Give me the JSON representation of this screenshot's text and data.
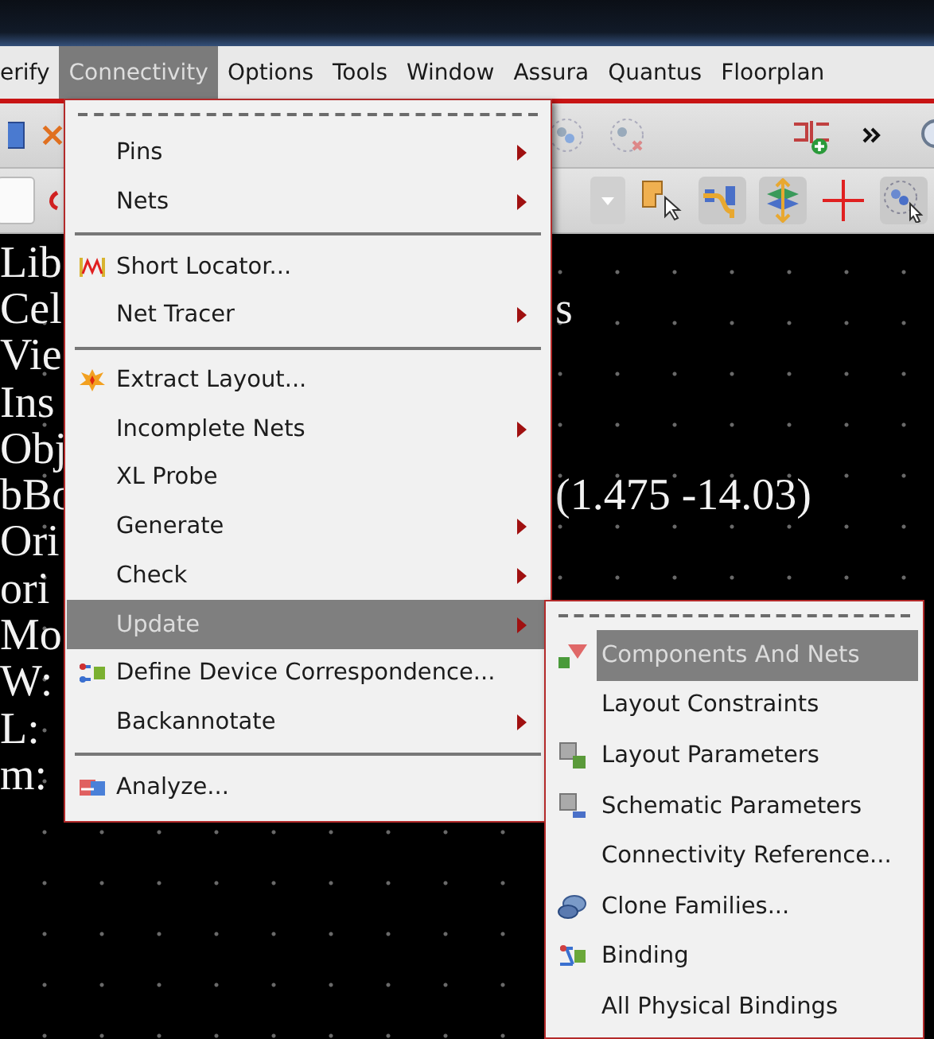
{
  "menubar": [
    {
      "label": "erify",
      "selected": false
    },
    {
      "label": "Connectivity",
      "selected": true
    },
    {
      "label": "Options",
      "selected": false
    },
    {
      "label": "Tools",
      "selected": false
    },
    {
      "label": "Window",
      "selected": false
    },
    {
      "label": "Assura",
      "selected": false
    },
    {
      "label": "Quantus",
      "selected": false
    },
    {
      "label": "Floorplan",
      "selected": false
    }
  ],
  "canvas_text": [
    {
      "left": "Lib"
    },
    {
      "left": "Cel",
      "right": "s"
    },
    {
      "left": "Vie"
    },
    {
      "left": "Ins"
    },
    {
      "left": "Obj"
    },
    {
      "left": "bBo",
      "right": "(1.475 -14.03)"
    },
    {
      "left": "Ori"
    },
    {
      "left": "ori"
    },
    {
      "left": "Mo"
    },
    {
      "left": "W:"
    },
    {
      "left": "L:"
    },
    {
      "left": "m:"
    }
  ],
  "menu": {
    "items": [
      {
        "kind": "dashed_separator"
      },
      {
        "kind": "item",
        "label": "Pins",
        "submenu": true,
        "selected": false,
        "icon": false
      },
      {
        "kind": "item",
        "label": "Nets",
        "submenu": true,
        "selected": false,
        "icon": false
      },
      {
        "kind": "separator"
      },
      {
        "kind": "item",
        "label": "Short Locator...",
        "submenu": false,
        "selected": false,
        "icon": true
      },
      {
        "kind": "item",
        "label": "Net Tracer",
        "submenu": true,
        "selected": false,
        "icon": false
      },
      {
        "kind": "separator"
      },
      {
        "kind": "item",
        "label": "Extract Layout...",
        "submenu": false,
        "selected": false,
        "icon": true
      },
      {
        "kind": "item",
        "label": "Incomplete Nets",
        "submenu": true,
        "selected": false,
        "icon": false
      },
      {
        "kind": "item",
        "label": "XL Probe",
        "submenu": false,
        "selected": false,
        "icon": false
      },
      {
        "kind": "item",
        "label": "Generate",
        "submenu": true,
        "selected": false,
        "icon": false
      },
      {
        "kind": "item",
        "label": "Check",
        "submenu": true,
        "selected": false,
        "icon": false
      },
      {
        "kind": "item",
        "label": "Update",
        "submenu": true,
        "selected": true,
        "icon": false
      },
      {
        "kind": "item",
        "label": "Define Device Correspondence...",
        "submenu": false,
        "selected": false,
        "icon": true
      },
      {
        "kind": "item",
        "label": "Backannotate",
        "submenu": true,
        "selected": false,
        "icon": false
      },
      {
        "kind": "separator"
      },
      {
        "kind": "item",
        "label": "Analyze...",
        "submenu": false,
        "selected": false,
        "icon": true
      }
    ]
  },
  "submenu": {
    "items": [
      {
        "kind": "dashed_separator"
      },
      {
        "kind": "item",
        "label": "Components And Nets",
        "selected": true,
        "icon": true
      },
      {
        "kind": "item",
        "label": "Layout Constraints",
        "selected": false,
        "icon": false
      },
      {
        "kind": "item",
        "label": "Layout Parameters",
        "selected": false,
        "icon": true
      },
      {
        "kind": "item",
        "label": "Schematic Parameters",
        "selected": false,
        "icon": true
      },
      {
        "kind": "item",
        "label": "Connectivity Reference...",
        "selected": false,
        "icon": false
      },
      {
        "kind": "item",
        "label": "Clone Families...",
        "selected": false,
        "icon": true
      },
      {
        "kind": "item",
        "label": "Binding",
        "selected": false,
        "icon": true
      },
      {
        "kind": "item",
        "label": "All Physical Bindings",
        "selected": false,
        "icon": false
      }
    ]
  }
}
